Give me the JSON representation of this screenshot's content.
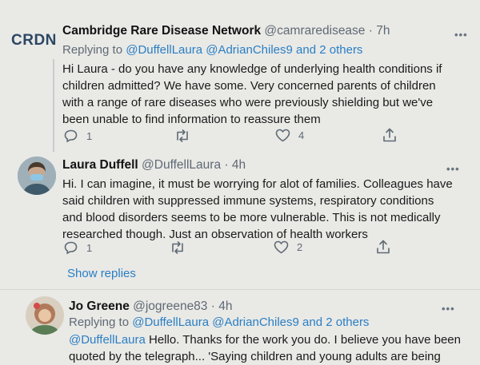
{
  "tweets": [
    {
      "avatar_text": "CRDN",
      "name": "Cambridge Rare Disease Network",
      "handle": "@camraredisease",
      "time": "· 7h",
      "reply_prefix": "Replying to",
      "reply_to_1": "@DuffellLaura",
      "reply_to_2": "@AdrianChiles9",
      "reply_and": "and",
      "reply_others": "2 others",
      "lines": [
        "Hi Laura - do you have any knowledge of underlying health conditions if",
        "children admitted? We have some. Very concerned parents of children",
        "with a range of rare diseases who were previously shielding but we've",
        "been unable to find information to reassure them"
      ],
      "replies": "1",
      "likes": "4"
    },
    {
      "name": "Laura Duffell",
      "handle": "@DuffellLaura",
      "time": "· 4h",
      "lines": [
        "Hi. I can imagine, it must be worrying for alot of families. Colleagues have",
        "said children with suppressed immune systems, respiratory conditions",
        "and blood disorders seems to be more vulnerable. This is not medically",
        "researched though. Just an observation of health workers"
      ],
      "replies": "1",
      "likes": "2"
    },
    {
      "name": "Jo Greene",
      "handle": "@jogreene83",
      "time": "· 4h",
      "reply_prefix": "Replying to",
      "reply_to_1": "@DuffellLaura",
      "reply_to_2": "@AdrianChiles9",
      "reply_and": "and",
      "reply_others": "2 others",
      "mention": "@DuffellLaura",
      "line1_rest": " Hello. Thanks for the work you do. I believe you have been",
      "line2": "quoted by the telegraph... 'Saying children and young adults are being"
    }
  ],
  "show_replies": "Show replies",
  "more_glyph": "•••",
  "colors": {
    "link": "#2a7fc4",
    "muted": "#5f6a74",
    "background": "#e9e9e6"
  }
}
